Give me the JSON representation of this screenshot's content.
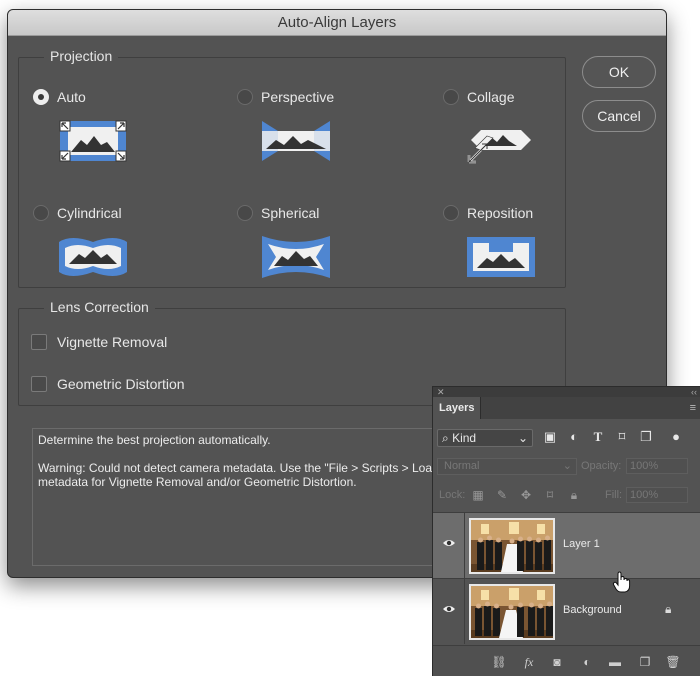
{
  "dialog": {
    "title": "Auto-Align Layers",
    "projection": {
      "legend": "Projection",
      "options": [
        {
          "label": "Auto",
          "selected": true,
          "icon": "auto-projection-icon"
        },
        {
          "label": "Perspective",
          "selected": false,
          "icon": "perspective-projection-icon"
        },
        {
          "label": "Collage",
          "selected": false,
          "icon": "collage-projection-icon"
        },
        {
          "label": "Cylindrical",
          "selected": false,
          "icon": "cylindrical-projection-icon"
        },
        {
          "label": "Spherical",
          "selected": false,
          "icon": "spherical-projection-icon"
        },
        {
          "label": "Reposition",
          "selected": false,
          "icon": "reposition-projection-icon"
        }
      ]
    },
    "lens": {
      "legend": "Lens Correction",
      "options": [
        {
          "label": "Vignette Removal",
          "checked": false
        },
        {
          "label": "Geometric Distortion",
          "checked": false
        }
      ]
    },
    "ok_label": "OK",
    "cancel_label": "Cancel",
    "description_line1": "Determine the best projection automatically.",
    "description_line2": "Warning: Could not detect camera metadata. Use the \"File > Scripts > Load Files into Stack...\" script to preserve metadata for Vignette Removal and/or Geometric Distortion."
  },
  "layers_panel": {
    "tab_label": "Layers",
    "filter_label": "Kind",
    "blend_mode": "Normal",
    "opacity_label": "Opacity:",
    "opacity_value": "100%",
    "lock_label": "Lock:",
    "fill_label": "Fill:",
    "fill_value": "100%",
    "layers": [
      {
        "name": "Layer 1",
        "selected": true,
        "locked": false
      },
      {
        "name": "Background",
        "selected": false,
        "locked": true
      }
    ]
  },
  "colors": {
    "dialog_bg": "#535353",
    "accent_blue": "#4f86d1",
    "selected_layer": "#6d6d6d"
  }
}
